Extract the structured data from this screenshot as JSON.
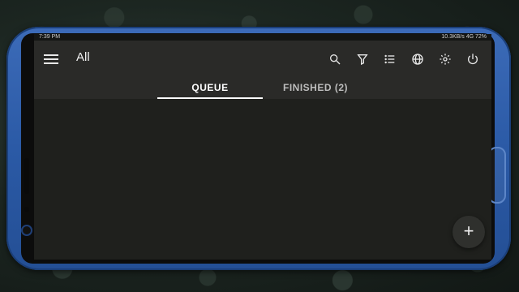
{
  "statusbar": {
    "left": "7:39 PM",
    "right": "10.3KB/s 4G 72%"
  },
  "appbar": {
    "title": "All"
  },
  "actions": [
    "search-icon",
    "filter-icon",
    "list-icon",
    "globe-icon",
    "settings-icon",
    "power-icon"
  ],
  "tabs": {
    "queue": "QUEUE",
    "finished": "FINISHED (2)"
  },
  "fab": {
    "label": "+"
  },
  "colors": {
    "appbar": "#2a2a28",
    "background": "#1f201d",
    "phone": "#2b5aa6"
  }
}
